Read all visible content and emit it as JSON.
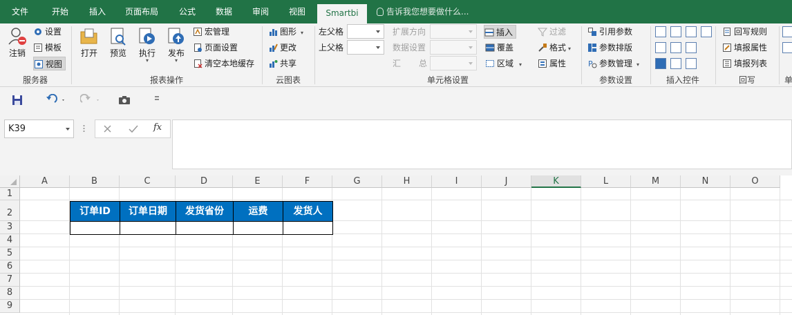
{
  "tabs": [
    "文件",
    "开始",
    "插入",
    "页面布局",
    "公式",
    "数据",
    "审阅",
    "视图",
    "Smartbi"
  ],
  "active_tab": "Smartbi",
  "tell_me": "告诉我您想要做什么...",
  "groups": {
    "server": {
      "label": "服务器",
      "logout": "注销",
      "settings": "设置",
      "template": "模板",
      "view": "视图"
    },
    "report_ops": {
      "label": "报表操作",
      "open": "打开",
      "preview": "预览",
      "execute": "执行",
      "publish": "发布",
      "macro": "宏管理",
      "page_setup": "页面设置",
      "clear_cache": "清空本地缓存"
    },
    "cloud_chart": {
      "label": "云图表",
      "graphic": "图形",
      "update": "更改",
      "share": "共享"
    },
    "cell_settings": {
      "label": "单元格设置",
      "left_parent": "左父格",
      "up_parent": "上父格",
      "expand_dir": "扩展方向",
      "data_settings": "数据设置",
      "summary_a": "汇",
      "summary_b": "总",
      "insert": "插入",
      "overwrite": "覆盖",
      "region": "区域",
      "filter": "过滤",
      "format": "格式",
      "attribute": "属性"
    },
    "param_settings": {
      "label": "参数设置",
      "ref_param": "引用参数",
      "param_layout": "参数排版",
      "param_manage": "参数管理"
    },
    "insert_controls": {
      "label": "插入控件"
    },
    "writeback": {
      "label": "回写",
      "rules": "回写规则",
      "fill_attr": "填报属性",
      "fill_list": "填报列表"
    },
    "cut_label": "单"
  },
  "name_box": "K39",
  "fx_label": "fx",
  "columns": [
    "A",
    "B",
    "C",
    "D",
    "E",
    "F",
    "G",
    "H",
    "I",
    "J",
    "K",
    "L",
    "M",
    "N",
    "O"
  ],
  "selected_column": "K",
  "rows": [
    "1",
    "2",
    "3",
    "4",
    "5",
    "6",
    "7",
    "8",
    "9"
  ],
  "table_headers": [
    "订单ID",
    "订单日期",
    "发货省份",
    "运费",
    "发货人"
  ],
  "colors": {
    "ribbon_green": "#217346",
    "header_blue": "#0070c0"
  }
}
